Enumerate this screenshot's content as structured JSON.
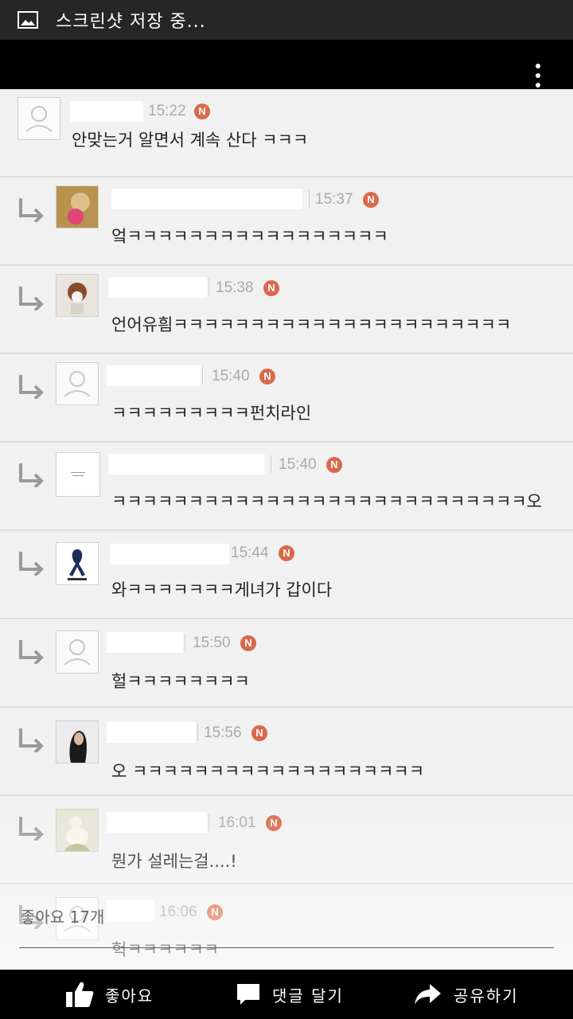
{
  "status": {
    "title": "스크린샷 저장 중..."
  },
  "comments": [
    {
      "time": "15:22",
      "badge": "N",
      "text": "안맞는거 알면서 계속 산다 ㅋㅋㅋ"
    },
    {
      "time": "15:37",
      "badge": "N",
      "text": "엌ㅋㅋㅋㅋㅋㅋㅋㅋㅋㅋㅋㅋㅋㅋㅋㅋㅋ"
    },
    {
      "time": "15:38",
      "badge": "N",
      "text": "언어유흼ㅋㅋㅋㅋㅋㅋㅋㅋㅋㅋㅋㅋㅋㅋㅋㅋㅋㅋㅋㅋㅋㅋ"
    },
    {
      "time": "15:40",
      "badge": "N",
      "text": "ㅋㅋㅋㅋㅋㅋㅋㅋㅋ펀치라인"
    },
    {
      "time": "15:40",
      "badge": "N",
      "text": "ㅋㅋㅋㅋㅋㅋㅋㅋㅋㅋㅋㅋㅋㅋㅋㅋㅋㅋㅋㅋㅋㅋㅋㅋㅋㅋㅋ오"
    },
    {
      "time": "15:44",
      "badge": "N",
      "text": "와ㅋㅋㅋㅋㅋㅋㅋ게녀가 갑이다"
    },
    {
      "time": "15:50",
      "badge": "N",
      "text": "헐ㅋㅋㅋㅋㅋㅋㅋㅋ"
    },
    {
      "time": "15:56",
      "badge": "N",
      "text": "오 ㅋㅋㅋㅋㅋㅋㅋㅋㅋㅋㅋㅋㅋㅋㅋㅋㅋㅋㅋ"
    },
    {
      "time": "16:01",
      "badge": "N",
      "text": "뭔가 설레는걸....!"
    },
    {
      "time": "16:06",
      "badge": "N",
      "text": "헉ㅋㅋㅋㅋㅋㅋ"
    }
  ],
  "overlay": {
    "likes": "좋아요 17개"
  },
  "actions": {
    "like": "좋아요",
    "comment": "댓글 달기",
    "share": "공유하기"
  },
  "colors": {
    "badge": "#d9694a",
    "background": "#f1f1f1",
    "bars": "#000000"
  }
}
